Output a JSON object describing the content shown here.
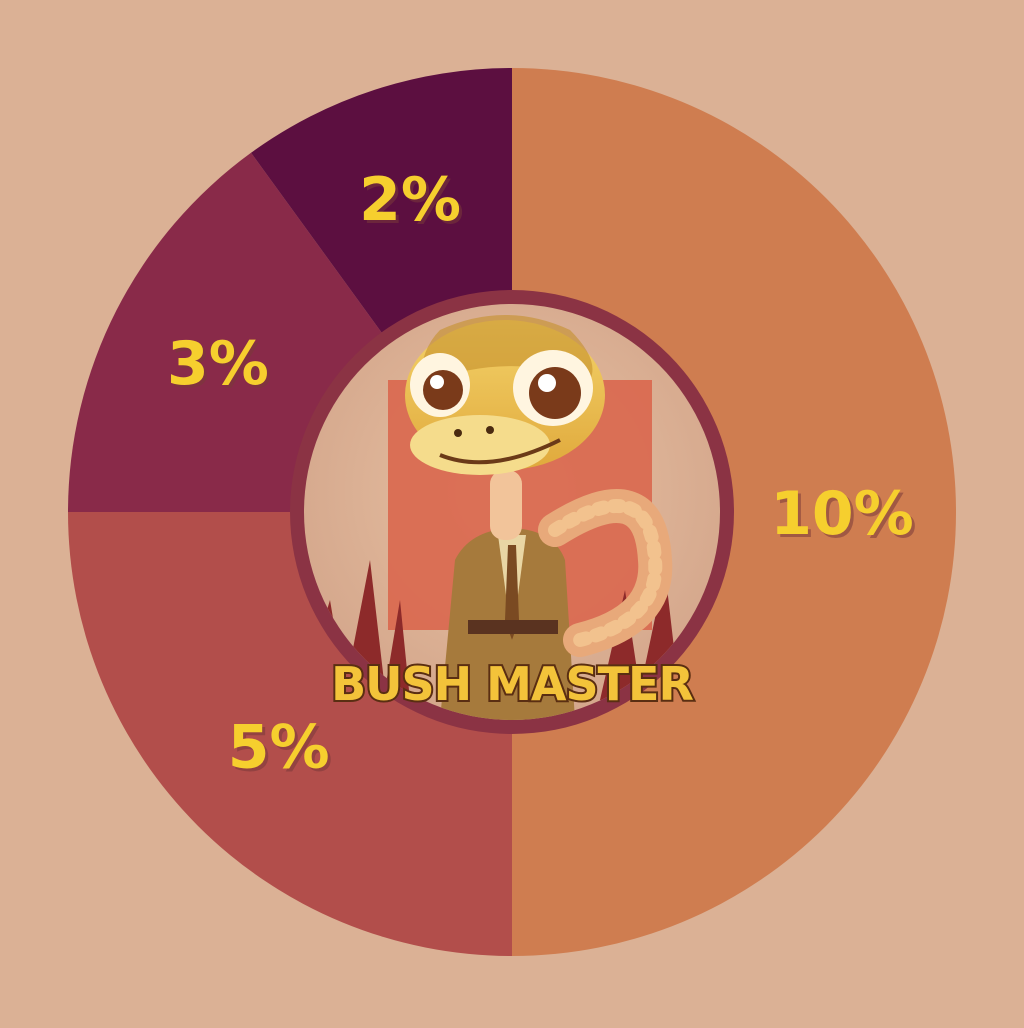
{
  "colors": {
    "background": "#dbb195",
    "ring_gap": "#dbb195",
    "label_text": "#f6cf2e",
    "emblem_border": "#8b3344"
  },
  "chart_data": {
    "type": "pie",
    "categories": [
      "10%",
      "5%",
      "3%",
      "2%"
    ],
    "values": [
      10,
      5,
      3,
      2
    ],
    "labels": [
      "10%",
      "5%",
      "3%",
      "2%"
    ],
    "colors": [
      "#cf7d50",
      "#b24e4b",
      "#892a49",
      "#5c0f40"
    ],
    "start": "top",
    "direction": "clockwise",
    "title": "",
    "legend": "none"
  },
  "emblem": {
    "logo_text": "BUSH MASTER",
    "icon": "snake-mascot-icon"
  }
}
